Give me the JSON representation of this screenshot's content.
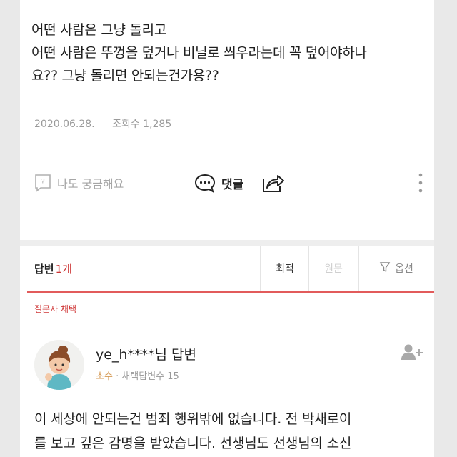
{
  "question": {
    "lines": [
      "어떤 사람은 그냥 돌리고",
      "어떤 사람은 뚜껑을 덮거나 비닐로 씌우라는데 꼭 덮어야하나",
      "요?? 그냥 돌리면 안되는건가용??"
    ],
    "date": "2020.06.28.",
    "views_label": "조회수",
    "views": "1,285"
  },
  "actions": {
    "curious": "나도 궁금해요",
    "comment": "댓글"
  },
  "answers": {
    "label": "답변",
    "count": "1개",
    "sort": {
      "latest": "최적",
      "recommend": "원문",
      "options": "옵션"
    }
  },
  "chosen_label": "질문자 채택",
  "answer": {
    "author": "ye_h****님 답변",
    "grade": "초수",
    "chosen_count_label": "채택답변수",
    "chosen_count": "15",
    "lines": [
      "이 세상에 안되는건 범죄 행위밖에 없습니다. 전 박새로이",
      "를 보고 깊은 감명을 받았습니다. 선생님도 선생님의 소신"
    ]
  },
  "colors": {
    "accent_red": "#e25b5b",
    "chosen_red": "#cf3535",
    "grade_orange": "#d59a55"
  }
}
